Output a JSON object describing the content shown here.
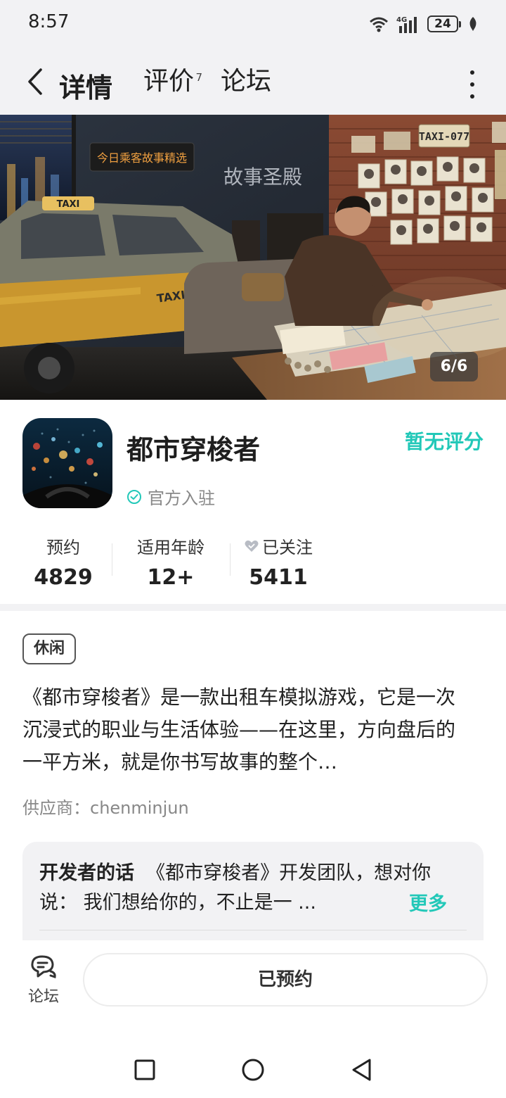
{
  "status_bar": {
    "time": "8:57",
    "network": "4G",
    "battery": "24",
    "icons": [
      "wifi-icon",
      "signal-icon",
      "battery-icon",
      "leaf-icon"
    ]
  },
  "header": {
    "tabs": [
      {
        "label": "详情",
        "active": true
      },
      {
        "label": "评价",
        "badge": "7"
      },
      {
        "label": "论坛"
      }
    ],
    "icons": [
      "back-arrow-icon",
      "more-vertical-icon"
    ]
  },
  "banner": {
    "page_counter": "6/6",
    "sign_text": "今日乘客故事精选",
    "wall_text": "故事圣殿",
    "plate_text": "TAXI-077",
    "roof_sign": "TAXI",
    "door_text": "TAXI"
  },
  "app": {
    "name": "都市穿梭者",
    "official_label": "官方入驻",
    "rating_text": "暂无评分"
  },
  "stats": [
    {
      "label": "预约",
      "value": "4829"
    },
    {
      "label": "适用年龄",
      "value": "12+"
    },
    {
      "label": "已关注",
      "value": "5411",
      "icon": "heart-icon"
    }
  ],
  "tag": "休闲",
  "description": "《都市穿梭者》是一款出租车模拟游戏，它是一次沉浸式的职业与生活体验——在这里，方向盘后的一平方米，就是你书写故事的整个…",
  "supplier": "供应商：chenminjun",
  "developer_note": {
    "title": "开发者的话",
    "text": "《都市穿梭者》开发团队，想对你说： 我们想给你的，不止是一 ...",
    "more_label": "更多"
  },
  "bottom_bar": {
    "forum_label": "论坛",
    "reserve_label": "已预约"
  },
  "colors": {
    "accent": "#22c8b8",
    "background": "#ffffff",
    "header_bg": "#f2f2f4"
  }
}
